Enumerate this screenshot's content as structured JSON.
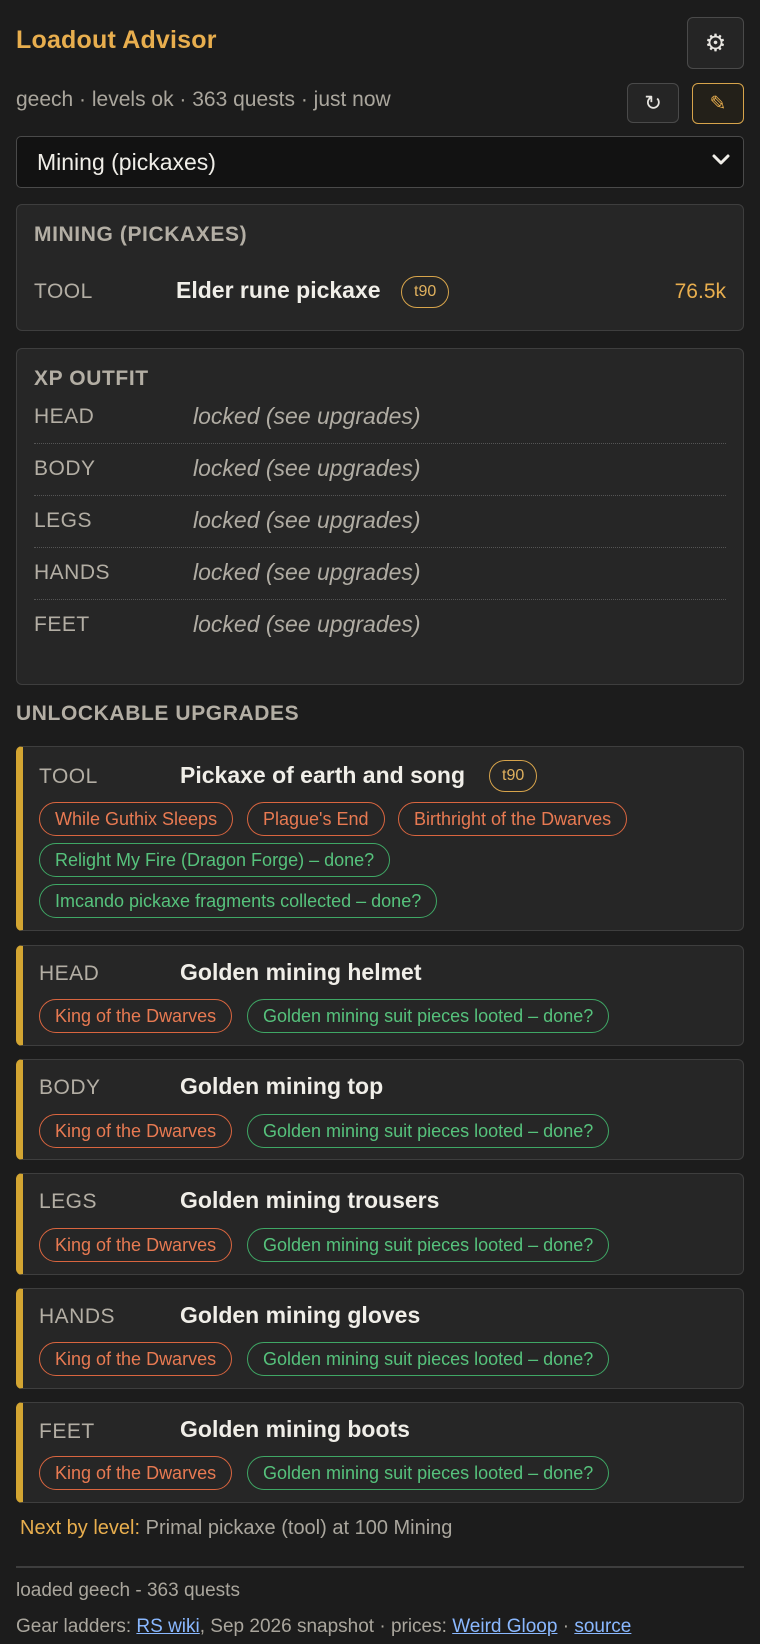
{
  "header": {
    "title": "Loadout Advisor",
    "settings_icon": "⚙",
    "status": "geech · levels ok · 363 quests · just now",
    "refresh_icon": "↻",
    "edit_icon": "✎"
  },
  "skill_select": {
    "value": "Mining (pickaxes)"
  },
  "current_tool": {
    "title": "MINING (PICKAXES)",
    "slot": "TOOL",
    "name": "Elder rune pickaxe",
    "tier": "t90",
    "price": "76.5k"
  },
  "xp_outfit": {
    "title": "XP OUTFIT",
    "rows": [
      {
        "slot": "HEAD",
        "value": "locked (see upgrades)"
      },
      {
        "slot": "BODY",
        "value": "locked (see upgrades)"
      },
      {
        "slot": "LEGS",
        "value": "locked (see upgrades)"
      },
      {
        "slot": "HANDS",
        "value": "locked (see upgrades)"
      },
      {
        "slot": "FEET",
        "value": "locked (see upgrades)"
      }
    ]
  },
  "upgrades": {
    "title": "UNLOCKABLE UPGRADES",
    "items": [
      {
        "slot": "TOOL",
        "name": "Pickaxe of earth and song",
        "tier": "t90",
        "requirements": [
          "While Guthix Sleeps",
          "Plague's End",
          "Birthright of the Dwarves",
          "Relight My Fire (Dragon Forge) – done?",
          "Imcando pickaxe fragments collected – done?"
        ]
      },
      {
        "slot": "HEAD",
        "name": "Golden mining helmet",
        "requirements": [
          "King of the Dwarves",
          "Golden mining suit pieces looted – done?"
        ]
      },
      {
        "slot": "BODY",
        "name": "Golden mining top",
        "requirements": [
          "King of the Dwarves",
          "Golden mining suit pieces looted – done?"
        ]
      },
      {
        "slot": "LEGS",
        "name": "Golden mining trousers",
        "requirements": [
          "King of the Dwarves",
          "Golden mining suit pieces looted – done?"
        ]
      },
      {
        "slot": "HANDS",
        "name": "Golden mining gloves",
        "requirements": [
          "King of the Dwarves",
          "Golden mining suit pieces looted – done?"
        ]
      },
      {
        "slot": "FEET",
        "name": "Golden mining boots",
        "requirements": [
          "King of the Dwarves",
          "Golden mining suit pieces looted – done?"
        ]
      }
    ]
  },
  "next_by_level": {
    "label": "Next by level:",
    "text": "Primal pickaxe (tool) at 100 Mining"
  },
  "footer": {
    "loaded": "loaded geech - 363 quests",
    "ladders_prefix": "Gear ladders:",
    "rs_wiki": "RS wiki",
    "snapshot": ", Sep 2026 snapshot · prices:",
    "weird_gloop": "Weird Gloop",
    "sep": "·",
    "source": "source"
  },
  "colors": {
    "accent": "#e8ae4e",
    "upgrade_bar": "#d3a532",
    "quest_chip": "#e87a52",
    "done_chip": "#56c27c",
    "link": "#8ab8ff"
  }
}
